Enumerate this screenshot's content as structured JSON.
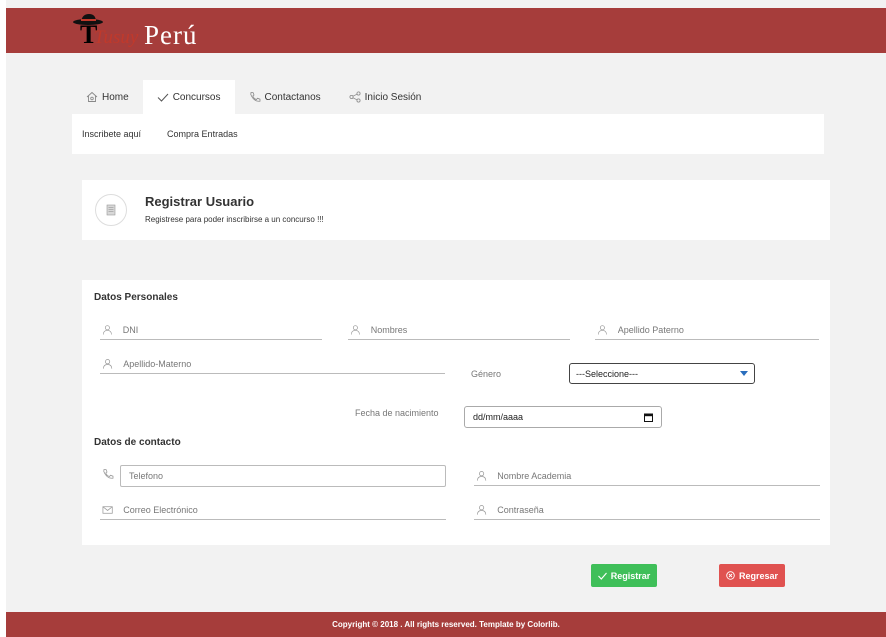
{
  "brand": {
    "logo_word": "Tusuy",
    "logo_word_2": "Perú"
  },
  "nav": {
    "tabs": [
      {
        "label": "Home",
        "icon": "home-icon"
      },
      {
        "label": "Concursos",
        "icon": "check-icon"
      },
      {
        "label": "Contactanos",
        "icon": "phone-icon"
      },
      {
        "label": "Inicio Sesión",
        "icon": "share-icon"
      }
    ],
    "subnav": [
      "Inscribete aquí",
      "Compra Entradas"
    ]
  },
  "header": {
    "title": "Registrar Usuario",
    "subtitle": "Registrese para poder inscribirse a un concurso !!!"
  },
  "form": {
    "personal_title": "Datos Personales",
    "dni_placeholder": "DNI",
    "nombres_placeholder": "Nombres",
    "apellido_paterno_placeholder": "Apellido Paterno",
    "apellido_materno_placeholder": "Apellido-Materno",
    "genero_label": "Género",
    "genero_selected": "---Seleccione---",
    "fecha_label": "Fecha de nacimiento",
    "fecha_placeholder": "dd/mm/aaaa",
    "contact_title": "Datos de contacto",
    "telefono_placeholder": "Telefono",
    "academia_placeholder": "Nombre Academia",
    "correo_placeholder": "Correo Electrónico",
    "contrasena_placeholder": "Contraseña"
  },
  "actions": {
    "register_label": "Registrar",
    "back_label": "Regresar"
  },
  "footer": {
    "text": "Copyright © 2018 . All rights reserved. Template by Colorlib."
  },
  "colors": {
    "brand": "#a63d3b",
    "success": "#3fbf59",
    "danger": "#e05250"
  }
}
